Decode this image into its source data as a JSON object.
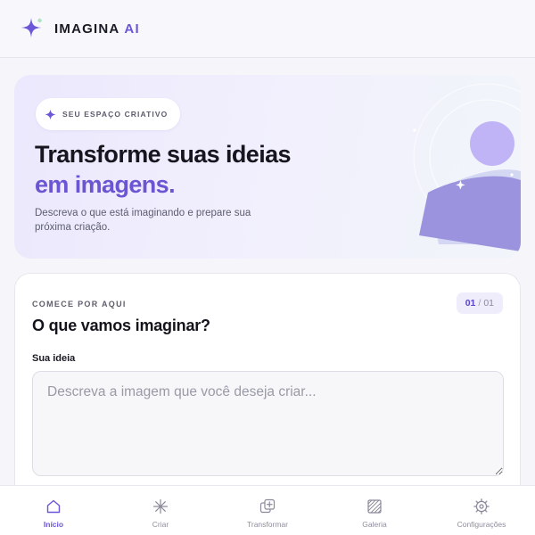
{
  "header": {
    "brand_name": "IMAGINA",
    "brand_accent": "AI",
    "logo_icon": "sparkle-icon"
  },
  "hero": {
    "badge": "SEU ESPAÇO CRIATIVO",
    "badge_icon": "sparkle-icon",
    "title_line1": "Transforme suas ideias",
    "title_line2": "em imagens.",
    "subtitle": "Descreva o que está imaginando e prepare sua próxima criação.",
    "illustration_icon": "abstract-landscape-illustration"
  },
  "card": {
    "eyebrow": "COMECE POR AQUI",
    "title": "O que vamos imaginar?",
    "step_current": "01",
    "step_separator": "/",
    "step_total": "01",
    "field_label": "Sua ideia",
    "field_placeholder": "Descreva a imagem que você deseja criar...",
    "field_value": ""
  },
  "nav": {
    "items": [
      {
        "label": "Início",
        "icon": "home-icon",
        "active": true
      },
      {
        "label": "Criar",
        "icon": "sparkle-burst-icon",
        "active": false
      },
      {
        "label": "Transformar",
        "icon": "image-plus-icon",
        "active": false
      },
      {
        "label": "Galeria",
        "icon": "gallery-icon",
        "active": false
      },
      {
        "label": "Configurações",
        "icon": "gear-icon",
        "active": false
      }
    ]
  },
  "colors": {
    "accent": "#6a56d6",
    "background": "#f6f6fa",
    "hero_gradient_start": "#ece8fd",
    "hero_gradient_end": "#f1f5fa",
    "text_primary": "#14141c",
    "text_muted": "#8e8e9e"
  }
}
